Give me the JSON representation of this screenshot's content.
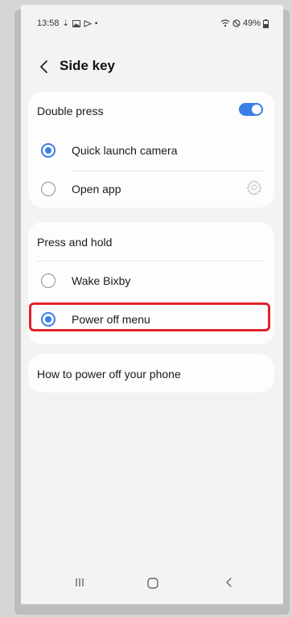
{
  "status_bar": {
    "time": "13:58",
    "battery": "49%"
  },
  "header": {
    "title": "Side key"
  },
  "double_press": {
    "label": "Double press",
    "toggle_on": true,
    "options": [
      {
        "label": "Quick launch camera",
        "selected": true
      },
      {
        "label": "Open app",
        "selected": false
      }
    ]
  },
  "press_and_hold": {
    "label": "Press and hold",
    "options": [
      {
        "label": "Wake Bixby",
        "selected": false
      },
      {
        "label": "Power off menu",
        "selected": true
      }
    ]
  },
  "help": {
    "label": "How to power off your phone"
  },
  "colors": {
    "accent": "#3a7ee8",
    "highlight": "#e2222b"
  }
}
